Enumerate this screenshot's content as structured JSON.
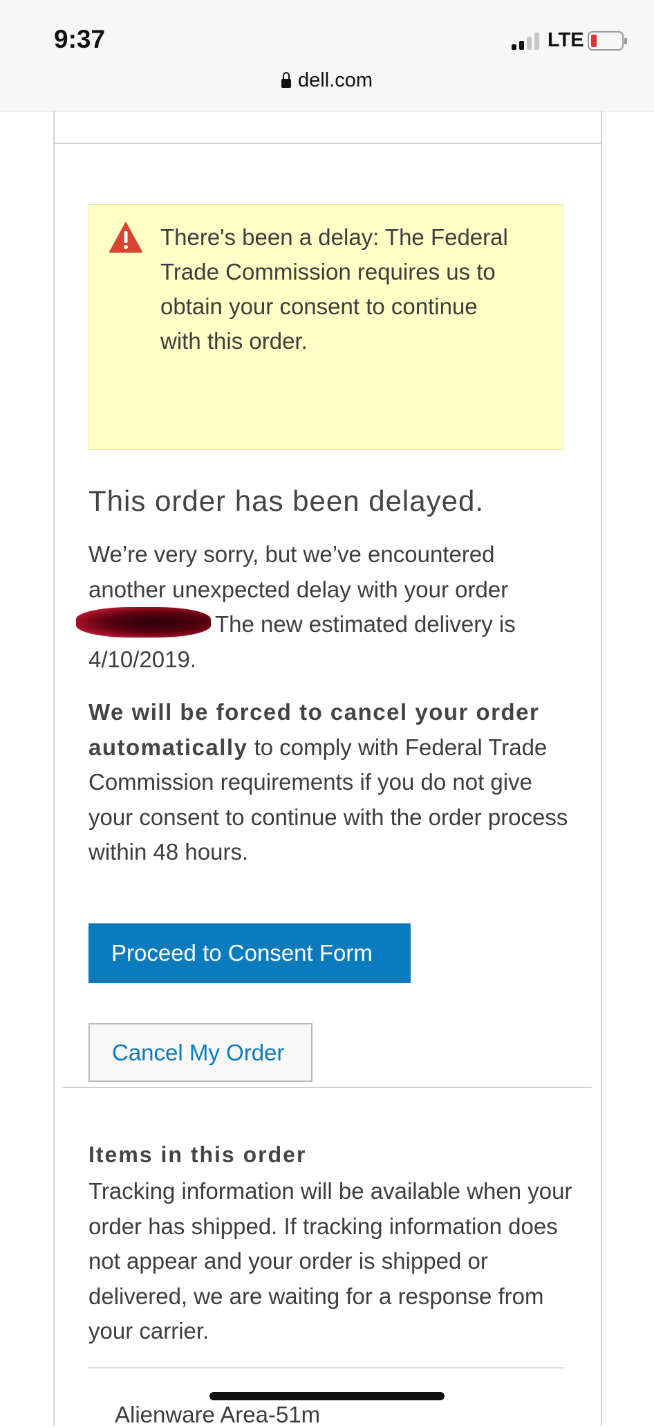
{
  "status_bar": {
    "time": "9:37",
    "network": "LTE",
    "signal_bars_active": 2,
    "battery_level_fraction": 0.12
  },
  "browser": {
    "url": "dell.com"
  },
  "alert": {
    "icon": "warning-triangle-icon",
    "text": "There's been a delay: The Federal Trade Commission requires us to obtain your consent to continue with this order.",
    "background": "#ffffc6",
    "icon_color": "#d9432f"
  },
  "delay": {
    "heading": "This order has been delayed.",
    "paragraph_before": "We’re very sorry, but we’ve encountered another unexpected delay with your order",
    "paragraph_after": "The new estimated delivery is 4/10/2019.",
    "warning_strong": "We will be forced to cancel your order automatically",
    "warning_rest": " to comply with Federal Trade Commission requirements if you do not give your consent to continue with the order process within 48 hours."
  },
  "actions": {
    "primary_label": "Proceed to Consent Form",
    "secondary_label": "Cancel My Order",
    "primary_color": "#0b7bbd"
  },
  "items": {
    "heading": "Items in this order",
    "tracking_text": "Tracking information will be available when your order has shipped. If tracking information does not appear and your order is shipped or delivered, we are waiting for a response from your carrier.",
    "first_item_partial": "Alienware Area-51m"
  }
}
